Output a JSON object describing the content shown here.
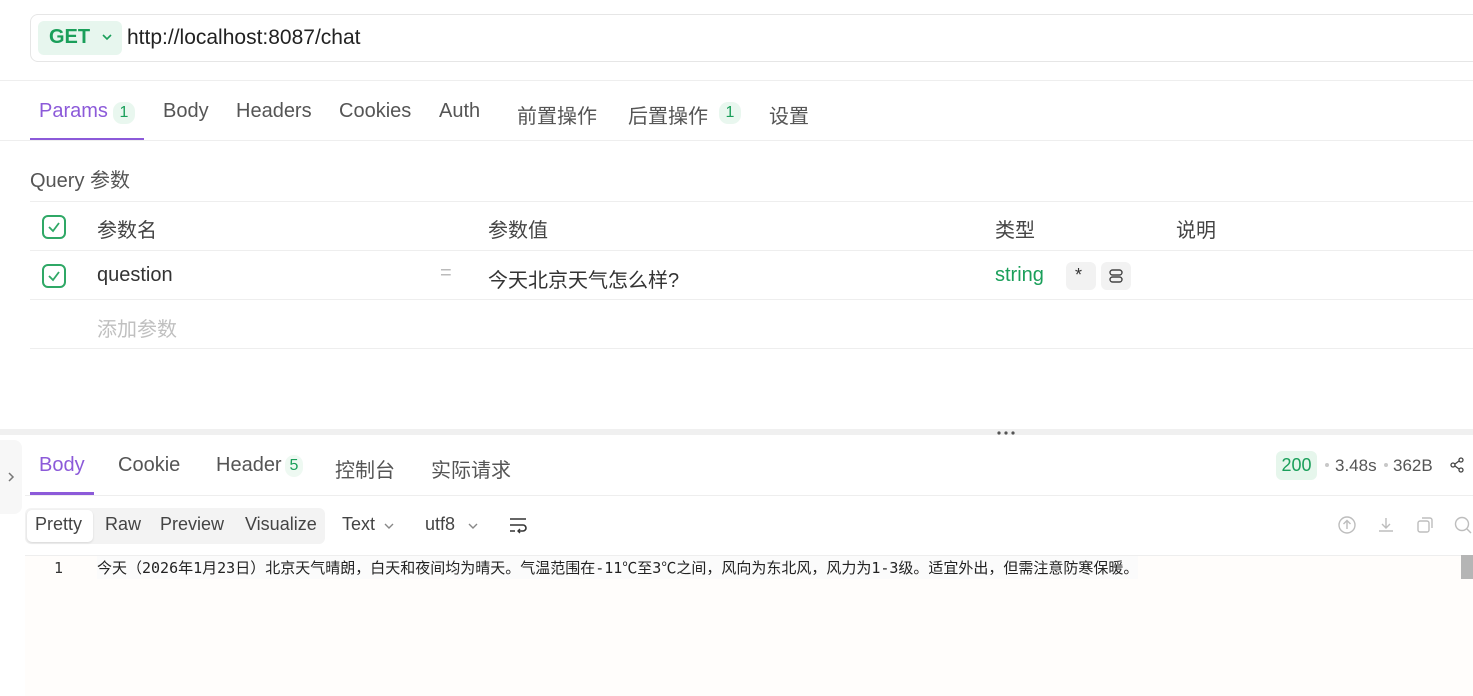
{
  "request": {
    "method": "GET",
    "url": "http://localhost:8087/chat"
  },
  "request_tabs": [
    {
      "label": "Params",
      "count": "1",
      "active": true
    },
    {
      "label": "Body"
    },
    {
      "label": "Headers"
    },
    {
      "label": "Cookies"
    },
    {
      "label": "Auth"
    },
    {
      "label": "前置操作"
    },
    {
      "label": "后置操作",
      "count": "1"
    },
    {
      "label": "设置"
    }
  ],
  "params": {
    "section_title": "Query 参数",
    "headers": {
      "name": "参数名",
      "value": "参数值",
      "type": "类型",
      "desc": "说明"
    },
    "rows": [
      {
        "checked": true,
        "name": "question",
        "eq": "=",
        "value": "今天北京天气怎么样?",
        "type": "string",
        "required": "*"
      }
    ],
    "add_placeholder": "添加参数"
  },
  "response_tabs": [
    {
      "label": "Body",
      "active": true
    },
    {
      "label": "Cookie"
    },
    {
      "label": "Header",
      "count": "5"
    },
    {
      "label": "控制台"
    },
    {
      "label": "实际请求"
    }
  ],
  "response_meta": {
    "status": "200",
    "time": "3.48s",
    "size": "362B"
  },
  "view_modes": [
    "Pretty",
    "Raw",
    "Preview",
    "Visualize"
  ],
  "format_select": "Text",
  "encoding_select": "utf8",
  "editor": {
    "line_number": "1",
    "line_text": "今天（2026年1月23日）北京天气晴朗，白天和夜间均为晴天。气温范围在-11℃至3℃之间，风向为东北风，风力为1-3级。适宜外出，但需注意防寒保暖。"
  },
  "colors": {
    "accent": "#8c5ad9",
    "success": "#1a9f5a"
  },
  "icons": [
    "chevron-down-icon",
    "check-icon",
    "link-icon",
    "wrap-icon",
    "upload-icon",
    "download-icon",
    "copy-icon",
    "search-icon",
    "share-icon",
    "chevron-right-icon"
  ]
}
